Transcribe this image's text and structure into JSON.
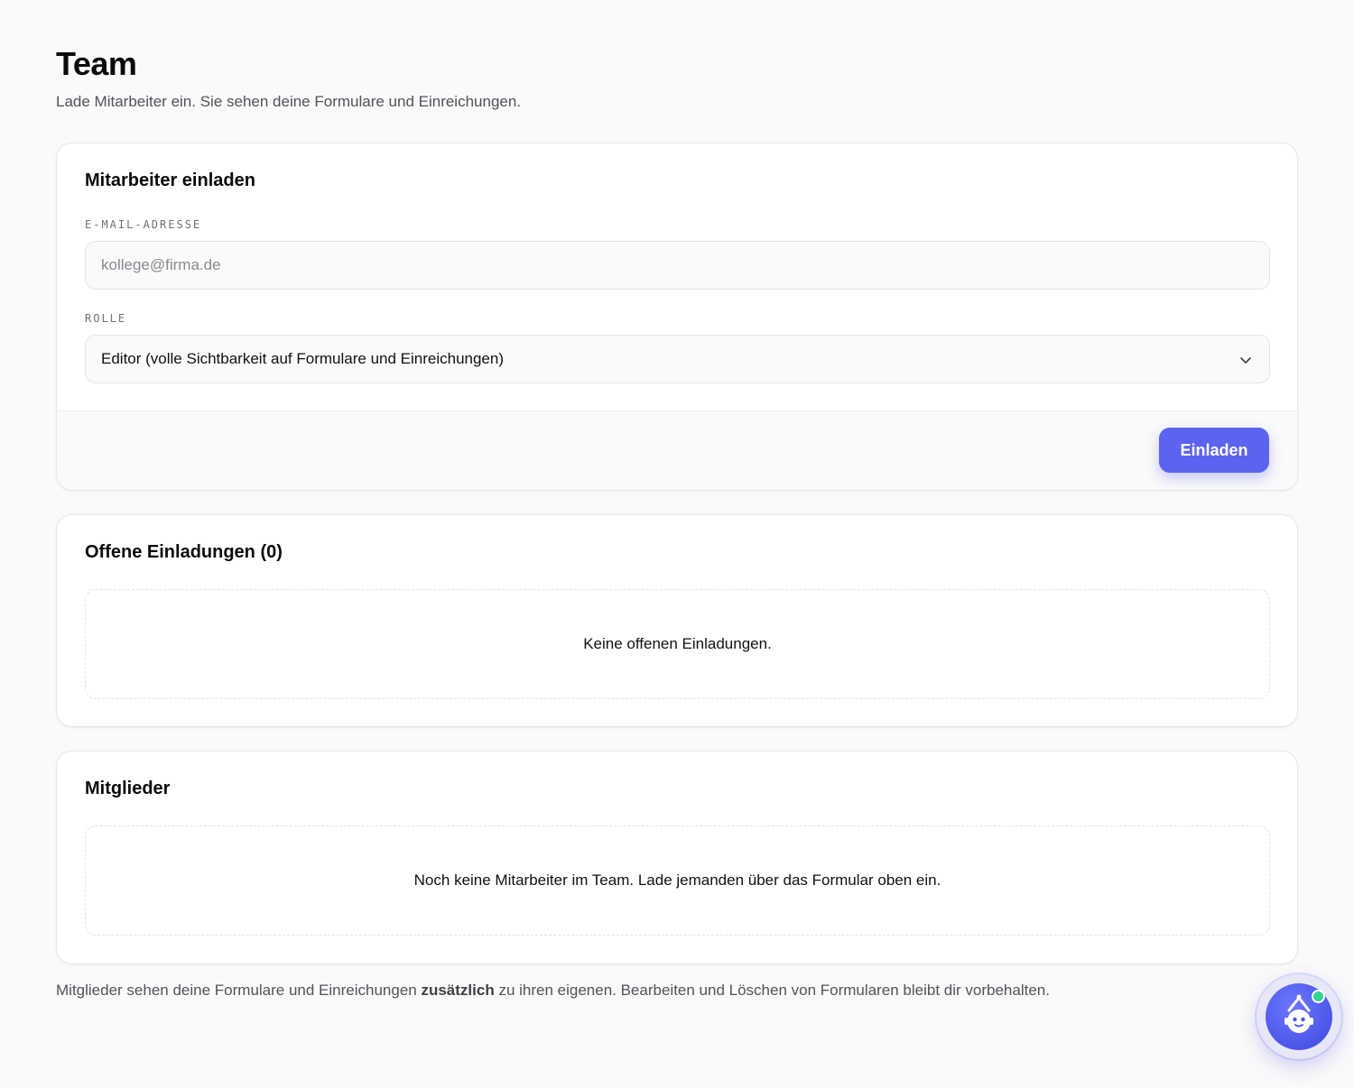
{
  "header": {
    "title": "Team",
    "subtitle": "Lade Mitarbeiter ein. Sie sehen deine Formulare und Einreichungen."
  },
  "invite_card": {
    "title": "Mitarbeiter einladen",
    "email_label": "E-MAIL-ADRESSE",
    "email_placeholder": "kollege@firma.de",
    "email_value": "",
    "role_label": "ROLLE",
    "role_selected": "Editor (volle Sichtbarkeit auf Formulare und Einreichungen)",
    "invite_button": "Einladen"
  },
  "pending_card": {
    "title": "Offene Einladungen (0)",
    "empty_text": "Keine offenen Einladungen."
  },
  "members_card": {
    "title": "Mitglieder",
    "empty_text": "Noch keine Mitarbeiter im Team. Lade jemanden über das Formular oben ein."
  },
  "footnote": {
    "before": "Mitglieder sehen deine Formulare und Einreichungen ",
    "emphasis": "zusätzlich",
    "after": " zu ihren eigenen. Bearbeiten und Löschen von Formularen bleibt dir vorbehalten."
  },
  "assistant": {
    "icon": "robot-assistant-icon",
    "status_color": "#34d399"
  },
  "colors": {
    "accent": "#5b63f0",
    "background": "#fafafa",
    "card": "#ffffff"
  }
}
